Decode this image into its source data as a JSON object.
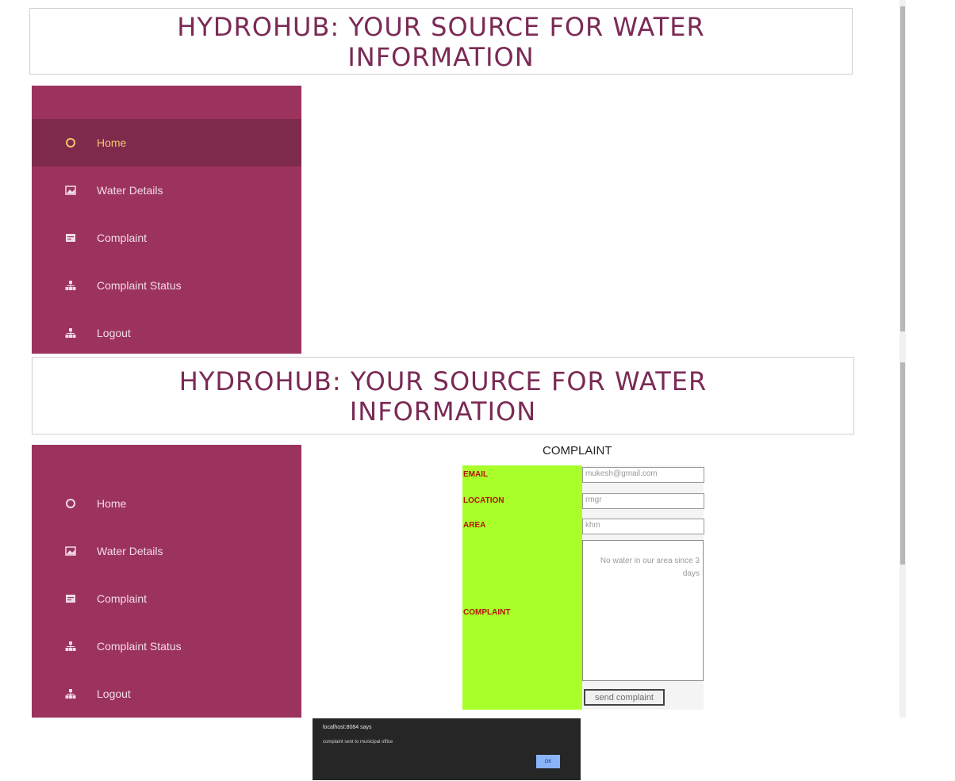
{
  "header": {
    "title": "HYDROHUB: YOUR SOURCE FOR WATER INFORMATION"
  },
  "sidebar": {
    "items": [
      {
        "label": "Home",
        "icon": "home-icon"
      },
      {
        "label": "Water Details",
        "icon": "image-icon"
      },
      {
        "label": "Complaint",
        "icon": "card-icon"
      },
      {
        "label": "Complaint Status",
        "icon": "sitemap-icon"
      },
      {
        "label": "Logout",
        "icon": "sitemap-icon"
      }
    ]
  },
  "form": {
    "title": "COMPLAINT",
    "email_label": "EMAIL",
    "email_value": "mukesh@gmail.com",
    "location_label": "LOCATION",
    "location_value": "rmgr",
    "area_label": "AREA",
    "area_value": "khm",
    "complaint_label": "COMPLAINT",
    "complaint_value": "No water in our area since 3 days",
    "send_label": "send complaint"
  },
  "dialog": {
    "title": "localhost:8084 says",
    "message": "complaint sent to municipal office",
    "ok_label": "OK"
  },
  "colors": {
    "sidebar": "#9c335e",
    "sidebar_active": "#7e2a4d",
    "header_text": "#7a2a55",
    "form_label_bg": "#a8ff2a",
    "form_label_text": "#b3150b"
  }
}
